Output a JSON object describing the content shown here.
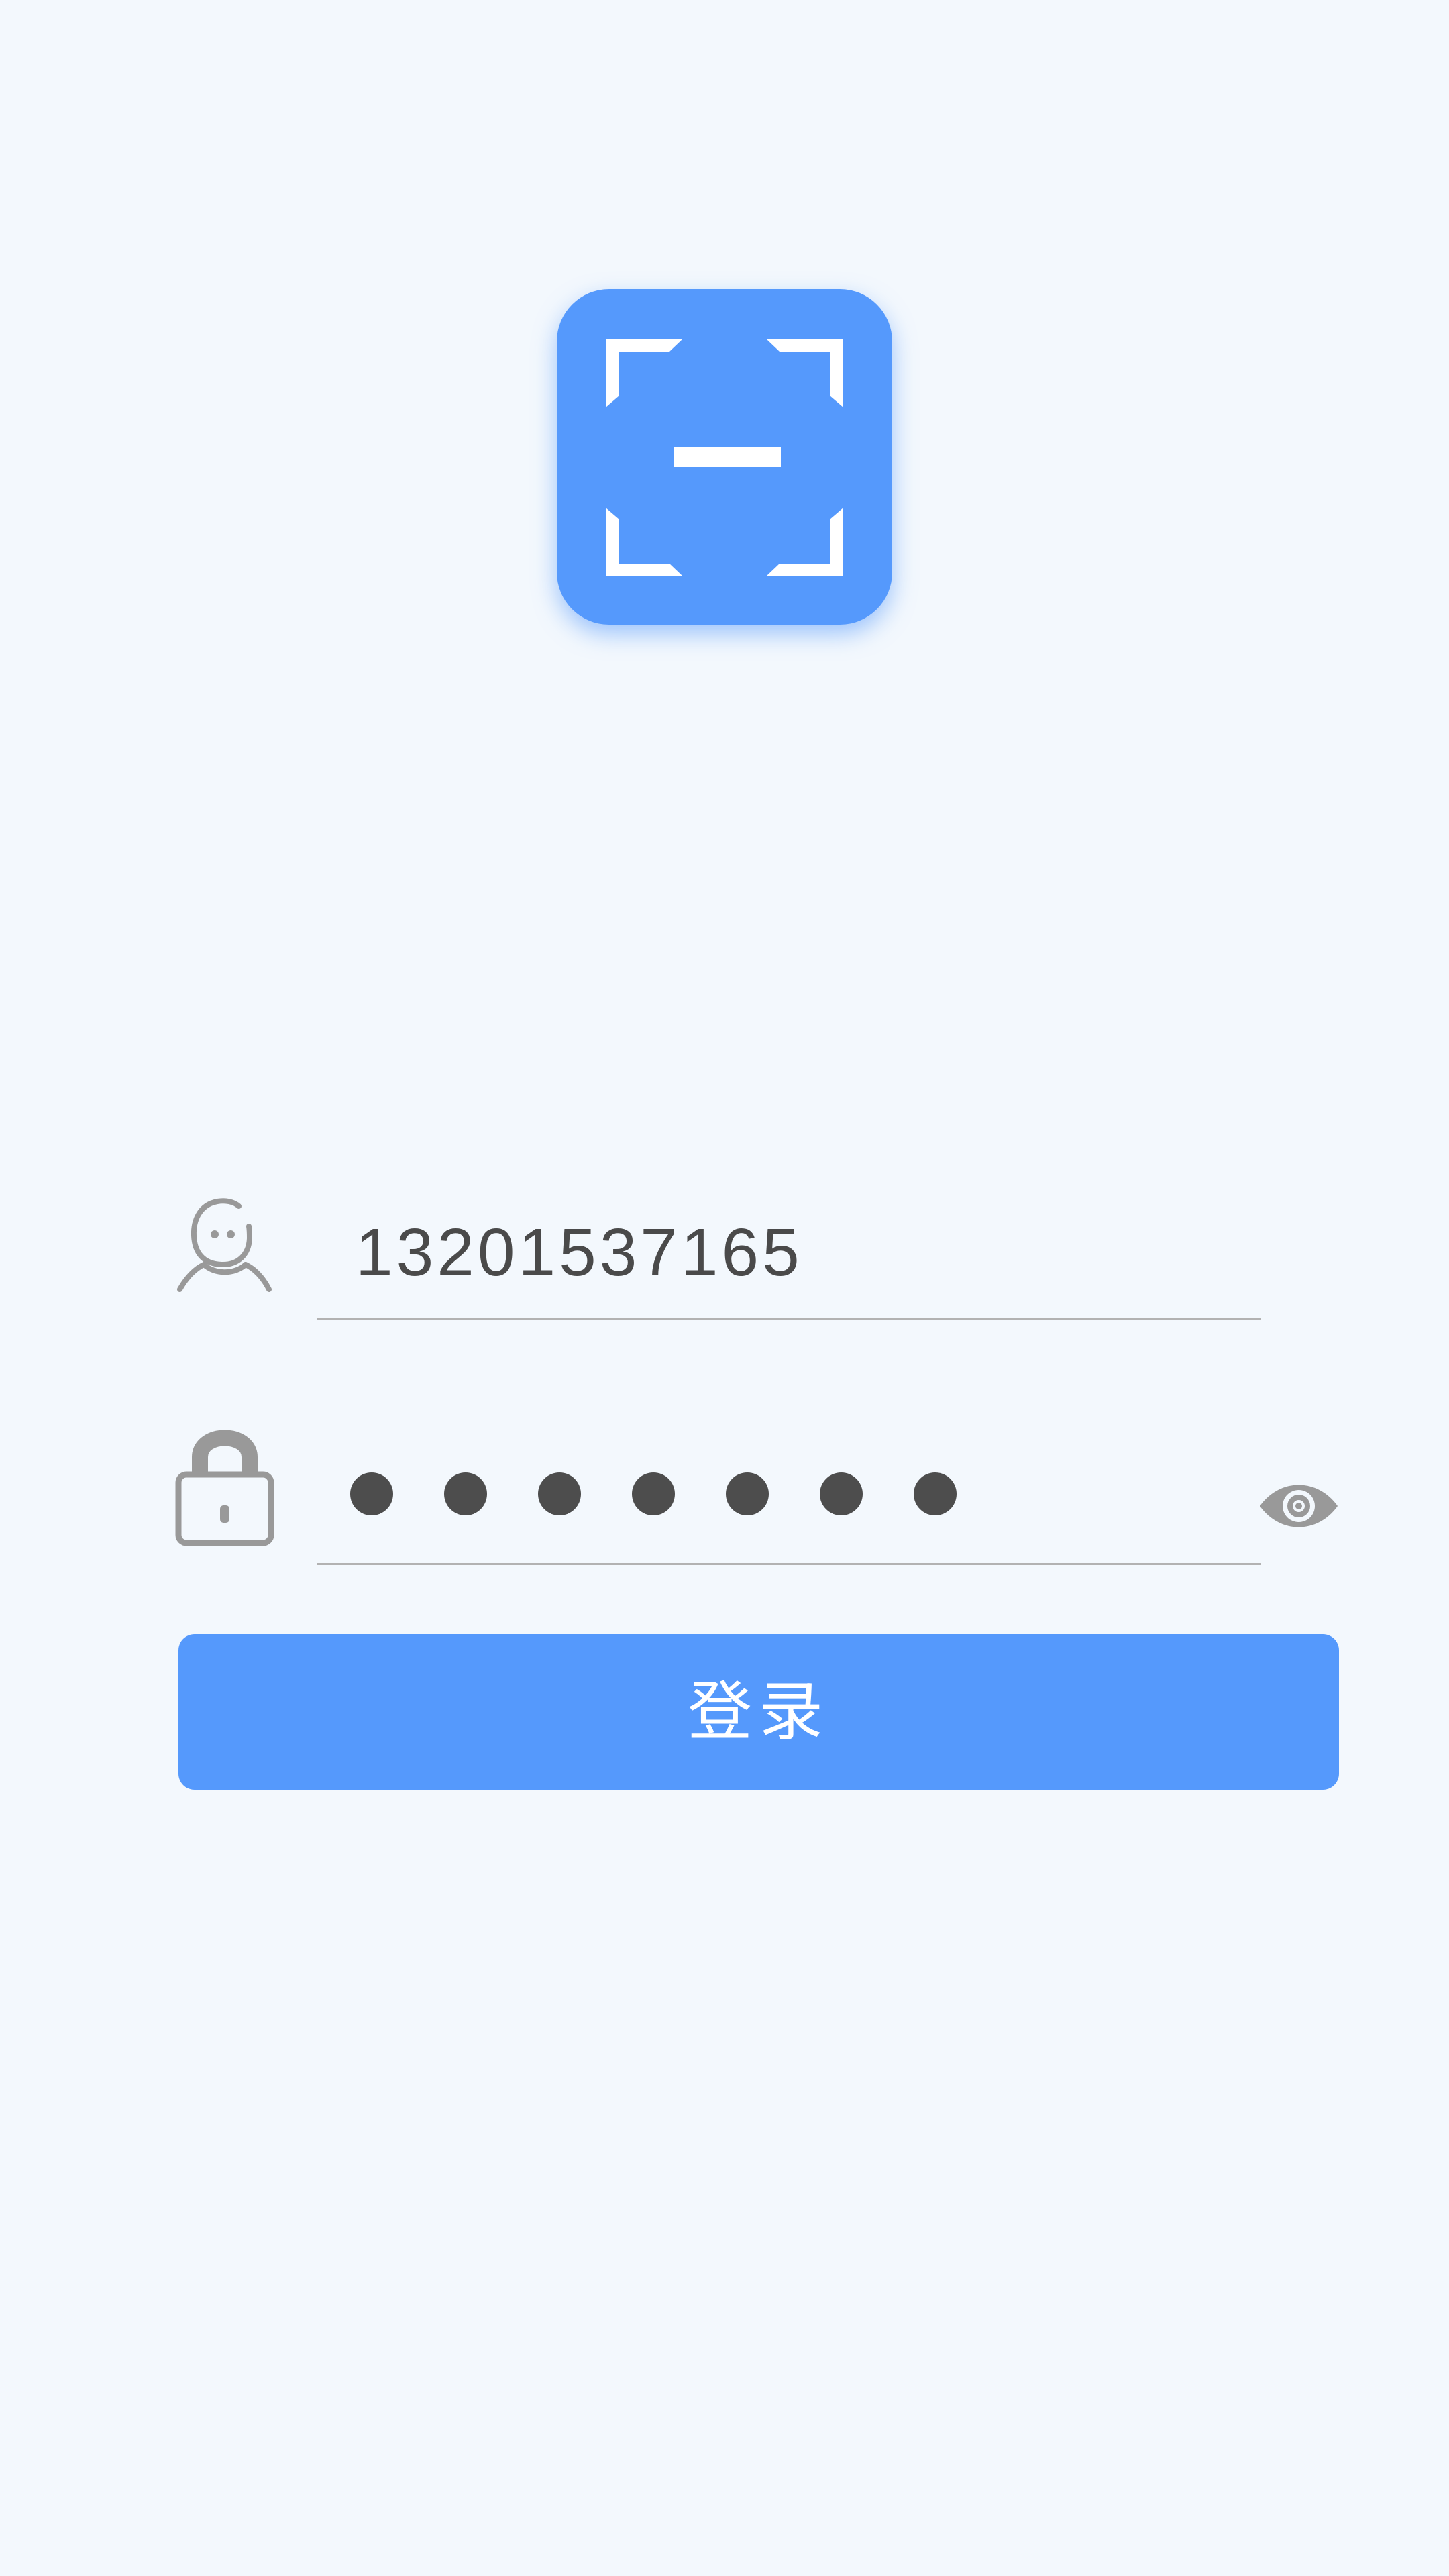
{
  "app": {
    "logo_icon": "scan-frame-icon",
    "accent_color": "#5599fc",
    "background_color": "#f3f8fd"
  },
  "login_form": {
    "account": {
      "icon": "user-icon",
      "value": "13201537165"
    },
    "password": {
      "icon": "lock-icon",
      "masked_length": 7,
      "visibility_toggle_icon": "eye-icon"
    },
    "submit_label": "登录"
  }
}
